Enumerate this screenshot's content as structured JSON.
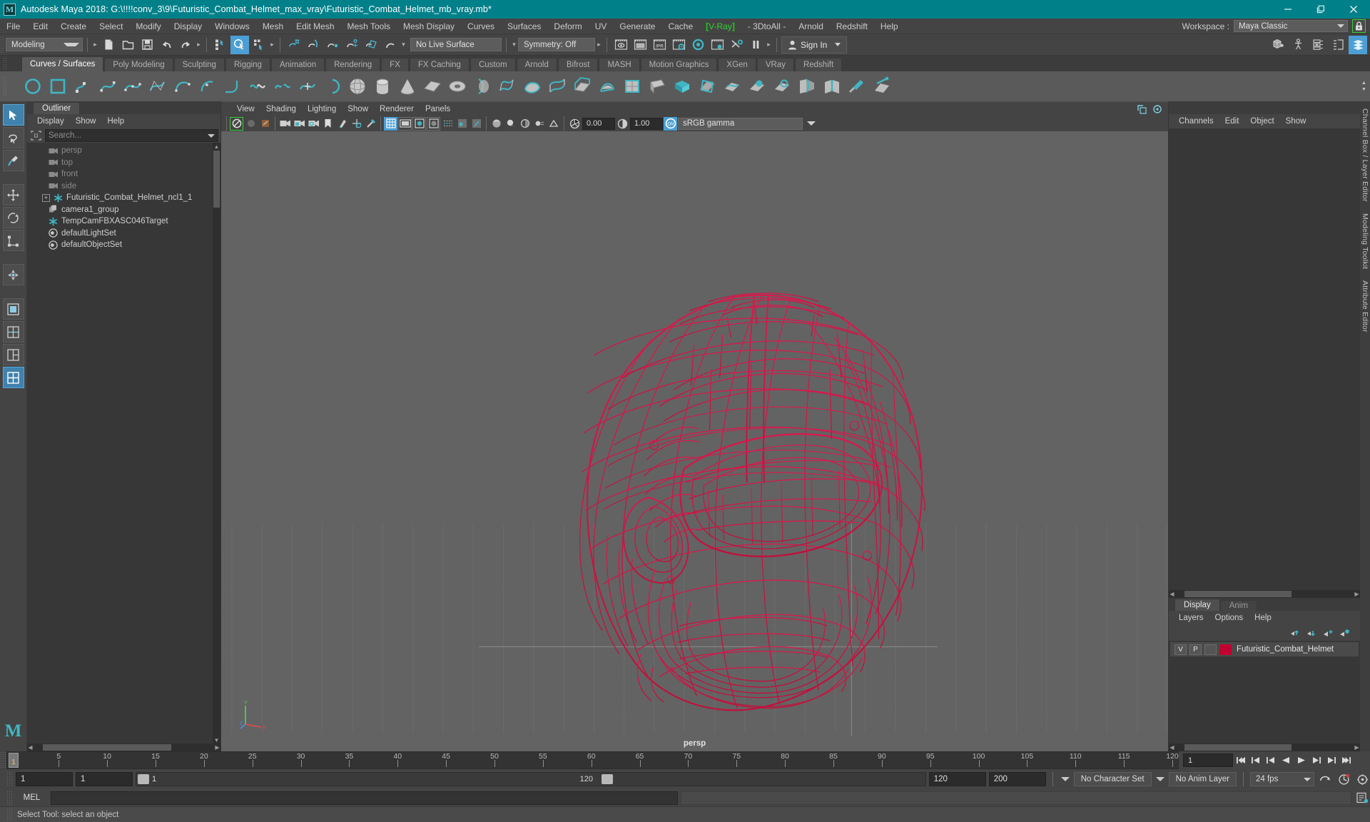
{
  "titlebar": {
    "app_title": "Autodesk Maya 2018: G:\\!!!!conv_3\\9\\Futuristic_Combat_Helmet_max_vray\\Futuristic_Combat_Helmet_mb_vray.mb*",
    "logo_glyph": "M",
    "window_controls": [
      {
        "name": "minimize-button",
        "label": "—"
      },
      {
        "name": "restore-button",
        "label": "❐"
      },
      {
        "name": "close-button",
        "label": "✕"
      }
    ],
    "accent_color": "#00818a"
  },
  "menubar": {
    "items": [
      {
        "label": "File"
      },
      {
        "label": "Edit"
      },
      {
        "label": "Create"
      },
      {
        "label": "Select"
      },
      {
        "label": "Modify"
      },
      {
        "label": "Display"
      },
      {
        "label": "Windows"
      },
      {
        "label": "Mesh"
      },
      {
        "label": "Edit Mesh"
      },
      {
        "label": "Mesh Tools"
      },
      {
        "label": "Mesh Display"
      },
      {
        "label": "Curves"
      },
      {
        "label": "Surfaces"
      },
      {
        "label": "Deform"
      },
      {
        "label": "UV"
      },
      {
        "label": "Generate"
      },
      {
        "label": "Cache"
      }
    ],
    "vray": {
      "label": "V-Ray",
      "bracket_open": "[",
      "bracket_close": "]",
      "color": "#33d133"
    },
    "items_after": [
      {
        "label": "- 3DtoAll -"
      },
      {
        "label": "Arnold"
      },
      {
        "label": "Redshift"
      },
      {
        "label": "Help"
      }
    ],
    "workspace_label": "Workspace :",
    "workspace_value": "Maya Classic",
    "lock_icon": "lock-icon",
    "lock_outline_color": "#35d035"
  },
  "statusline": {
    "menuset_value": "Modeling",
    "live_surface_value": "No Live Surface",
    "symmetry_value": "Symmetry: Off",
    "signin_label": "Sign In",
    "file_icons": [
      "new-scene-icon",
      "open-scene-icon",
      "save-scene-icon",
      "undo-icon",
      "redo-icon"
    ],
    "select_mode_icons": [
      "select-by-hierarchy-icon",
      "select-by-object-icon",
      "select-by-component-icon"
    ],
    "snap_icons": [
      "snap-to-grid-icon",
      "snap-to-curve-icon",
      "snap-to-point-icon",
      "snap-to-projected-center-icon",
      "snap-to-view-plane-icon",
      "make-live-icon"
    ],
    "render_icons": [
      "render-view-icon",
      "render-current-frame-icon",
      "ipr-render-icon",
      "render-settings-icon",
      "hypershade-icon",
      "render-setup-icon",
      "rendering-flags-icon",
      "pause-viewport-icon"
    ],
    "panel_toggle_icons": [
      "show-hide-modeling-toolkit-icon",
      "show-hide-humanik-icon",
      "show-hide-attribute-editor-icon",
      "show-hide-tool-settings-icon",
      "show-hide-channel-box-icon"
    ]
  },
  "shelf": {
    "tabs": [
      {
        "label": "Curves / Surfaces",
        "active": true
      },
      {
        "label": "Poly Modeling",
        "active": false
      },
      {
        "label": "Sculpting",
        "active": false
      },
      {
        "label": "Rigging",
        "active": false
      },
      {
        "label": "Animation",
        "active": false
      },
      {
        "label": "Rendering",
        "active": false
      },
      {
        "label": "FX",
        "active": false
      },
      {
        "label": "FX Caching",
        "active": false
      },
      {
        "label": "Custom",
        "active": false
      },
      {
        "label": "Arnold",
        "active": false
      },
      {
        "label": "Bifrost",
        "active": false
      },
      {
        "label": "MASH",
        "active": false
      },
      {
        "label": "Motion Graphics",
        "active": false
      },
      {
        "label": "XGen",
        "active": false
      },
      {
        "label": "VRay",
        "active": false
      },
      {
        "label": "Redshift",
        "active": false
      }
    ],
    "icons": [
      "nurbs-circle-icon",
      "nurbs-square-icon",
      "pencil-curve-icon",
      "bezier-curve-icon",
      "ep-curve-icon",
      "cv-curve-icon",
      "arc-three-point-icon",
      "arc-two-point-icon",
      "curve-fillet-icon",
      "attach-curves-icon",
      "detach-curves-icon",
      "insert-knot-icon",
      "open-close-curves-icon",
      "nurbs-sphere-icon",
      "nurbs-cylinder-icon",
      "nurbs-cone-icon",
      "nurbs-plane-icon",
      "nurbs-torus-icon",
      "revolve-icon",
      "loft-icon",
      "planar-icon",
      "birail-icon",
      "extrude-icon",
      "boundary-icon",
      "square-surface-icon",
      "bevel-icon",
      "bevel-plus-icon",
      "intersect-surfaces-icon",
      "project-curve-icon",
      "trim-tool-icon",
      "untrim-surfaces-icon",
      "surface-fillet-icon",
      "stitch-surface-icon",
      "sculpt-geometry-icon",
      "surface-editing-icon"
    ]
  },
  "toolbox": {
    "buttons": [
      {
        "name": "select-tool",
        "active": true
      },
      {
        "name": "lasso-select-tool",
        "active": false
      },
      {
        "name": "paint-select-tool",
        "active": false
      },
      {
        "name": "move-tool",
        "active": false
      },
      {
        "name": "rotate-tool",
        "active": false
      },
      {
        "name": "scale-tool",
        "active": false
      },
      {
        "name": "last-tool-used",
        "active": false
      },
      {
        "name": "single-view-layout",
        "active": false
      },
      {
        "name": "two-view-layout",
        "active": false
      },
      {
        "name": "three-view-layout",
        "active": false
      },
      {
        "name": "four-view-layout",
        "active": true
      }
    ],
    "badge_glyph": "M"
  },
  "outliner": {
    "tab_label": "Outliner",
    "menus": [
      "Display",
      "Show",
      "Help"
    ],
    "search_placeholder": "Search...",
    "items": [
      {
        "label": "persp",
        "icon": "camera-icon",
        "dim": true,
        "expandable": false
      },
      {
        "label": "top",
        "icon": "camera-icon",
        "dim": true,
        "expandable": false
      },
      {
        "label": "front",
        "icon": "camera-icon",
        "dim": true,
        "expandable": false
      },
      {
        "label": "side",
        "icon": "camera-icon",
        "dim": true,
        "expandable": false
      },
      {
        "label": "Futuristic_Combat_Helmet_ncl1_1",
        "icon": "transform-icon",
        "dim": false,
        "expandable": true
      },
      {
        "label": "camera1_group",
        "icon": "group-icon",
        "dim": false,
        "expandable": false
      },
      {
        "label": "TempCamFBXASC046Target",
        "icon": "transform-icon",
        "dim": false,
        "expandable": false
      },
      {
        "label": "defaultLightSet",
        "icon": "set-icon",
        "dim": false,
        "expandable": false
      },
      {
        "label": "defaultObjectSet",
        "icon": "set-icon",
        "dim": false,
        "expandable": false
      }
    ]
  },
  "viewport": {
    "menus": [
      "View",
      "Shading",
      "Lighting",
      "Show",
      "Renderer",
      "Panels"
    ],
    "exposure_value": "0.00",
    "gamma_value": "1.00",
    "color_management_value": "sRGB gamma",
    "camera_label": "persp",
    "axis_labels": {
      "y": "Y",
      "x": "X",
      "z": "Z"
    },
    "icons": [
      "select-camera-icon",
      "no-bookmark-icon",
      "image-plane-icon",
      "orthographic-icon",
      "lock-camera-icon",
      "camera-attributes-icon",
      "bookmark-icon",
      "two-d-pan-zoom-icon",
      "grease-pencil-icon",
      "snap-to-grid-icon",
      "grid-toggle-icon",
      "film-gate-icon",
      "resolution-gate-icon",
      "gate-mask-icon",
      "wireframe-on-shaded-icon",
      "xray-icon",
      "xray-joints-icon",
      "smooth-shade-icon",
      "shadows-icon",
      "ao-icon",
      "motion-blur-icon",
      "aa-icon",
      "exposure-icon",
      "gamma-icon",
      "color-management-on-icon"
    ],
    "background_color": "#636363",
    "wireframe_color": "#d81143",
    "grid_color": "#717171"
  },
  "channelbox": {
    "tabs_vertical": [
      "Channel Box / Layer Editor",
      "Modeling Toolkit",
      "Attribute Editor"
    ],
    "menus": [
      "Channels",
      "Edit",
      "Object",
      "Show"
    ]
  },
  "layers": {
    "tabs": [
      {
        "label": "Display",
        "active": true
      },
      {
        "label": "Anim",
        "active": false
      }
    ],
    "menus": [
      "Layers",
      "Options",
      "Help"
    ],
    "tool_icons": [
      "move-layer-up-icon",
      "move-layer-down-icon",
      "new-layer-icon",
      "new-layer-from-selected-icon"
    ],
    "rows": [
      {
        "visibility": "V",
        "playback": "P",
        "third_toggle": "",
        "color": "#c00030",
        "name": "Futuristic_Combat_Helmet"
      }
    ]
  },
  "timeslider": {
    "current_frame": "1",
    "start": 1,
    "end": 120,
    "tick_step": 5,
    "labels": [
      5,
      10,
      15,
      20,
      25,
      30,
      35,
      40,
      45,
      50,
      55,
      60,
      65,
      70,
      75,
      80,
      85,
      90,
      95,
      100,
      105,
      110,
      115,
      120
    ],
    "current_frame_field": "1",
    "playback_icons": [
      "go-to-start-icon",
      "step-back-frame-icon",
      "step-back-key-icon",
      "play-backwards-icon",
      "play-forwards-icon",
      "step-forward-key-icon",
      "step-forward-frame-icon",
      "go-to-end-icon"
    ]
  },
  "rangeslider": {
    "anim_start": "1",
    "range_start": "1",
    "bar_start_label": "1",
    "bar_end_label": "120",
    "range_end": "120",
    "anim_end": "200",
    "character_set": "No Character Set",
    "anim_layer": "No Anim Layer",
    "fps": "24 fps",
    "auto_key_icon": "auto-keyframe-icon",
    "anim_prefs_icon": "animation-preferences-icon",
    "playback_loop_icon": "playback-loop-icon"
  },
  "commandline": {
    "language_label": "MEL",
    "input_value": "",
    "output_value": "",
    "script_editor_icon": "script-editor-icon"
  },
  "helpline": {
    "text": "Select Tool: select an object"
  }
}
